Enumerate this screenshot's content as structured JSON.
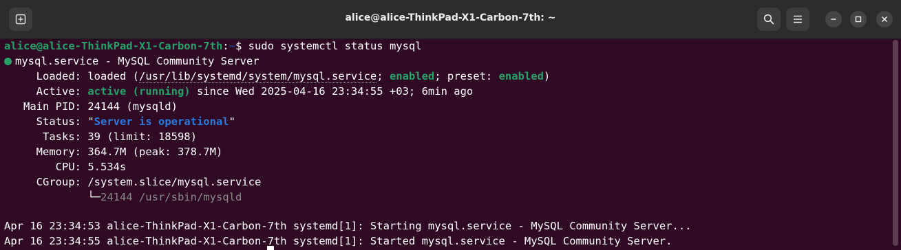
{
  "window": {
    "title": "alice@alice-ThinkPad-X1-Carbon-7th: ~"
  },
  "prompt": {
    "user_host": "alice@alice-ThinkPad-X1-Carbon-7th",
    "colon": ":",
    "path": "~",
    "dollar": "$ ",
    "command": "sudo systemctl status mysql"
  },
  "status": {
    "header": "mysql.service - MySQL Community Server",
    "loaded_label": "     Loaded: ",
    "loaded_prefix": "loaded (",
    "loaded_path": "/usr/lib/systemd/system/mysql.service",
    "loaded_sep1": "; ",
    "loaded_enabled": "enabled",
    "loaded_sep2": "; preset: ",
    "loaded_preset": "enabled",
    "loaded_suffix": ")",
    "active_label": "     Active: ",
    "active_state": "active (running)",
    "active_since": " since Wed 2025-04-16 23:34:55 +03; 6min ago",
    "mainpid_label": "   Main PID: ",
    "mainpid_value": "24144 (mysqld)",
    "statusline_label": "     Status: ",
    "statusline_quote_open": "\"",
    "statusline_value": "Server is operational",
    "statusline_quote_close": "\"",
    "tasks_label": "      Tasks: ",
    "tasks_value": "39 (limit: 18598)",
    "memory_label": "     Memory: ",
    "memory_value": "364.7M (peak: 378.7M)",
    "cpu_label": "        CPU: ",
    "cpu_value": "5.534s",
    "cgroup_label": "     CGroup: ",
    "cgroup_value": "/system.slice/mysql.service",
    "cgroup_tree": "             └─",
    "cgroup_process": "24144 /usr/sbin/mysqld"
  },
  "logs": [
    "Apr 16 23:34:53 alice-ThinkPad-X1-Carbon-7th systemd[1]: Starting mysql.service - MySQL Community Server...",
    "Apr 16 23:34:55 alice-ThinkPad-X1-Carbon-7th systemd[1]: Started mysql.service - MySQL Community Server."
  ],
  "colors": {
    "background": "#300a24",
    "titlebar": "#2c2c2c",
    "green": "#26a269",
    "blue": "#2a7bde"
  },
  "icons": [
    "new-tab-icon",
    "search-icon",
    "hamburger-menu-icon",
    "minimize-icon",
    "maximize-icon",
    "close-icon"
  ]
}
